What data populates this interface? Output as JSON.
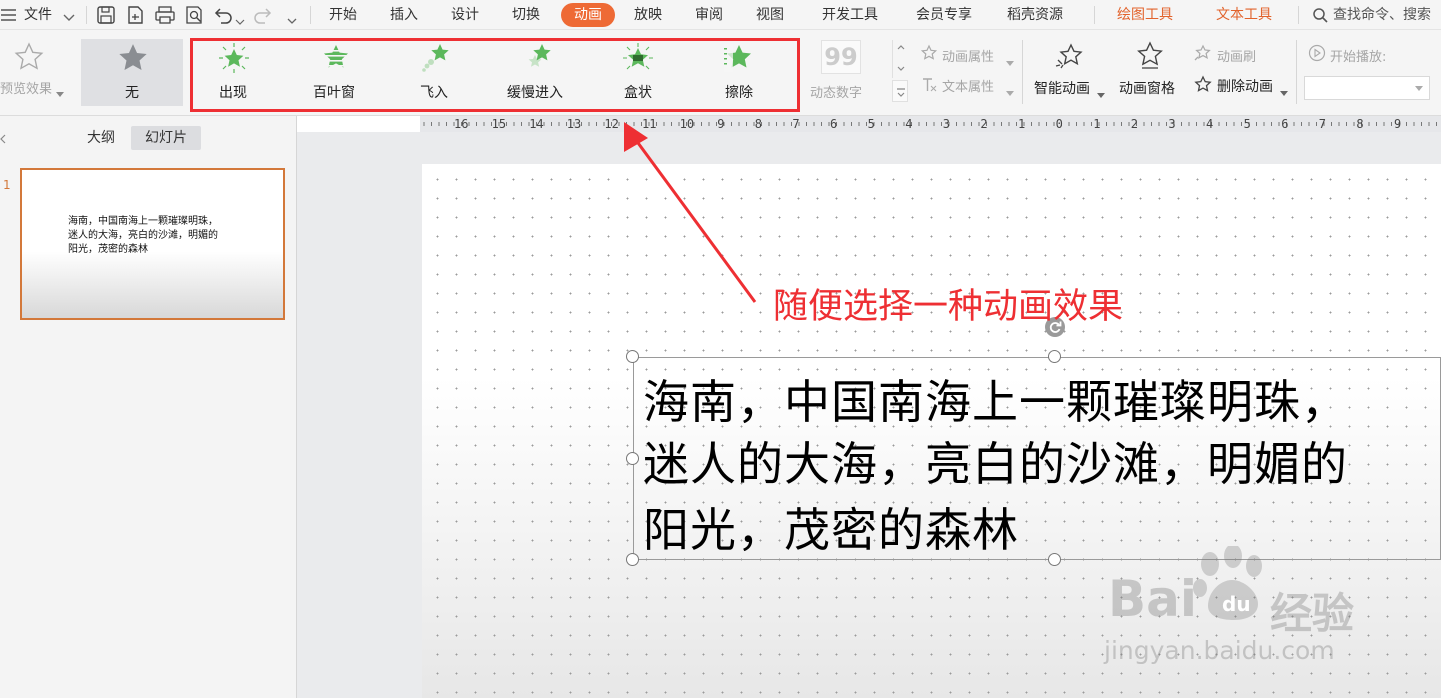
{
  "menu": {
    "file_label": "文件",
    "tabs": [
      "开始",
      "插入",
      "设计",
      "切换",
      "动画",
      "放映",
      "审阅",
      "视图",
      "开发工具",
      "会员专享",
      "稻壳资源"
    ],
    "context_tabs": [
      "绘图工具",
      "文本工具"
    ],
    "search_label": "查找命令、搜索"
  },
  "ribbon": {
    "preview_label": "预览效果",
    "none_label": "无",
    "effects": [
      "出现",
      "百叶窗",
      "飞入",
      "缓慢进入",
      "盒状",
      "擦除"
    ],
    "dynamic_number_label": "动态数字",
    "dynamic_number_icon_text": "99",
    "anim_attr_label": "动画属性",
    "text_attr_label": "文本属性",
    "smart_anim_label": "智能动画",
    "anim_pane_label": "动画窗格",
    "anim_brush_label": "动画刷",
    "delete_anim_label": "删除动画",
    "start_play_label": "开始播放:"
  },
  "ruler": {
    "numbers": [
      "16",
      "15",
      "14",
      "13",
      "12",
      "11",
      "10",
      "9",
      "8",
      "7",
      "6",
      "5",
      "4",
      "3",
      "2",
      "1",
      "0",
      "1",
      "2",
      "3",
      "4",
      "5",
      "6",
      "7",
      "8",
      "9"
    ]
  },
  "left_panel": {
    "tab_outline": "大纲",
    "tab_slides": "幻灯片",
    "slide_number": "1",
    "thumb_lines": [
      "海南，中国南海上一颗璀璨明珠，",
      "迷人的大海，亮白的沙滩，明媚的",
      "阳光，茂密的森林"
    ]
  },
  "slide": {
    "lines": [
      "海南，中国南海上一颗璀璨明珠，",
      "迷人的大海，亮白的沙滩，明媚的",
      "阳光，茂密的森林"
    ]
  },
  "annotation": {
    "text": "随便选择一种动画效果",
    "color": "#ee2f33"
  },
  "watermark": {
    "brand": "Bai",
    "brand_tail": "经验",
    "url": "jingyan.baidu.com"
  },
  "colors": {
    "accent": "#ee6a35",
    "effect_star": "#5cb85c",
    "highlight_box": "#ee2f33",
    "thumb_border": "#d3783a"
  }
}
